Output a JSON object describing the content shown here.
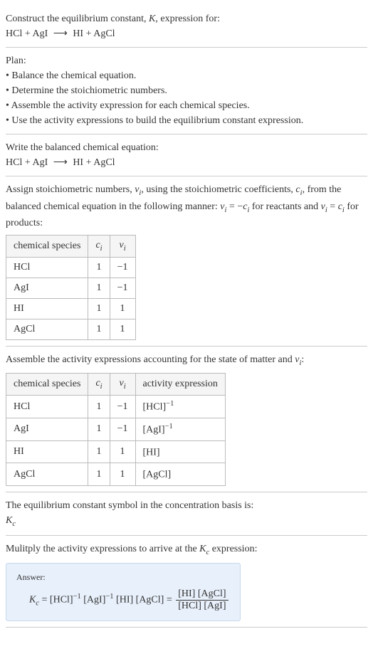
{
  "intro": {
    "line1_pre": "Construct the equilibrium constant, ",
    "line1_k": "K",
    "line1_post": ", expression for:",
    "equation_lhs": "HCl + AgI",
    "equation_arrow": "⟶",
    "equation_rhs": "HI + AgCl"
  },
  "plan": {
    "title": "Plan:",
    "b1": "• Balance the chemical equation.",
    "b2": "• Determine the stoichiometric numbers.",
    "b3": "• Assemble the activity expression for each chemical species.",
    "b4": "• Use the activity expressions to build the equilibrium constant expression."
  },
  "balanced": {
    "title": "Write the balanced chemical equation:",
    "lhs": "HCl + AgI",
    "arrow": "⟶",
    "rhs": "HI + AgCl"
  },
  "assign": {
    "text_p1": "Assign stoichiometric numbers, ",
    "nu": "ν",
    "i": "i",
    "text_p2": ", using the stoichiometric coefficients, ",
    "c": "c",
    "text_p3": ", from the balanced chemical equation in the following manner: ",
    "rel1_a": "ν",
    "rel1_b": " = −",
    "rel1_c": "c",
    "text_p4": " for reactants and ",
    "rel2_a": "ν",
    "rel2_b": " = ",
    "rel2_c": "c",
    "text_p5": " for products:",
    "headers": {
      "h1": "chemical species",
      "h2_a": "c",
      "h2_b": "i",
      "h3_a": "ν",
      "h3_b": "i"
    },
    "rows": [
      {
        "species": "HCl",
        "c": "1",
        "nu": "−1"
      },
      {
        "species": "AgI",
        "c": "1",
        "nu": "−1"
      },
      {
        "species": "HI",
        "c": "1",
        "nu": "1"
      },
      {
        "species": "AgCl",
        "c": "1",
        "nu": "1"
      }
    ]
  },
  "activity": {
    "text_p1": "Assemble the activity expressions accounting for the state of matter and ",
    "nu": "ν",
    "i": "i",
    "text_p2": ":",
    "headers": {
      "h1": "chemical species",
      "h2_a": "c",
      "h2_b": "i",
      "h3_a": "ν",
      "h3_b": "i",
      "h4": "activity expression"
    },
    "rows": [
      {
        "species": "HCl",
        "c": "1",
        "nu": "−1",
        "expr_base": "[HCl]",
        "expr_exp": "−1"
      },
      {
        "species": "AgI",
        "c": "1",
        "nu": "−1",
        "expr_base": "[AgI]",
        "expr_exp": "−1"
      },
      {
        "species": "HI",
        "c": "1",
        "nu": "1",
        "expr_base": "[HI]",
        "expr_exp": ""
      },
      {
        "species": "AgCl",
        "c": "1",
        "nu": "1",
        "expr_base": "[AgCl]",
        "expr_exp": ""
      }
    ]
  },
  "symbol": {
    "text": "The equilibrium constant symbol in the concentration basis is:",
    "k": "K",
    "c": "c"
  },
  "multiply": {
    "text_p1": "Mulitply the activity expressions to arrive at the ",
    "k": "K",
    "c": "c",
    "text_p2": " expression:"
  },
  "answer": {
    "label": "Answer:",
    "k": "K",
    "c": "c",
    "eq": " = ",
    "t1_base": "[HCl]",
    "t1_exp": "−1",
    "t2_base": "[AgI]",
    "t2_exp": "−1",
    "t3": "[HI]",
    "t4": "[AgCl]",
    "eq2": " = ",
    "num": "[HI] [AgCl]",
    "den": "[HCl] [AgI]"
  },
  "chart_data": {
    "type": "table",
    "tables": [
      {
        "title": "Stoichiometric numbers",
        "columns": [
          "chemical species",
          "c_i",
          "nu_i"
        ],
        "rows": [
          [
            "HCl",
            1,
            -1
          ],
          [
            "AgI",
            1,
            -1
          ],
          [
            "HI",
            1,
            1
          ],
          [
            "AgCl",
            1,
            1
          ]
        ]
      },
      {
        "title": "Activity expressions",
        "columns": [
          "chemical species",
          "c_i",
          "nu_i",
          "activity expression"
        ],
        "rows": [
          [
            "HCl",
            1,
            -1,
            "[HCl]^-1"
          ],
          [
            "AgI",
            1,
            -1,
            "[AgI]^-1"
          ],
          [
            "HI",
            1,
            1,
            "[HI]"
          ],
          [
            "AgCl",
            1,
            1,
            "[AgCl]"
          ]
        ]
      }
    ]
  }
}
